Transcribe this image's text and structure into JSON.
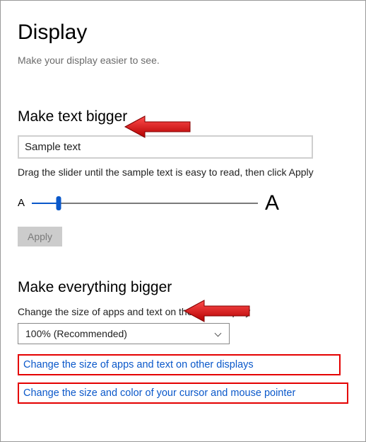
{
  "page": {
    "title": "Display",
    "subtitle": "Make your display easier to see."
  },
  "section1": {
    "title": "Make text bigger",
    "sample": "Sample text",
    "caption": "Drag the slider until the sample text is easy to read, then click Apply",
    "letterSmall": "A",
    "letterLarge": "A",
    "applyLabel": "Apply"
  },
  "section2": {
    "title": "Make everything bigger",
    "label": "Change the size of apps and text on the main display",
    "dropdownValue": "100% (Recommended)",
    "link1": "Change the size of apps and text on other displays",
    "link2": "Change the size and color of your cursor and mouse pointer"
  }
}
